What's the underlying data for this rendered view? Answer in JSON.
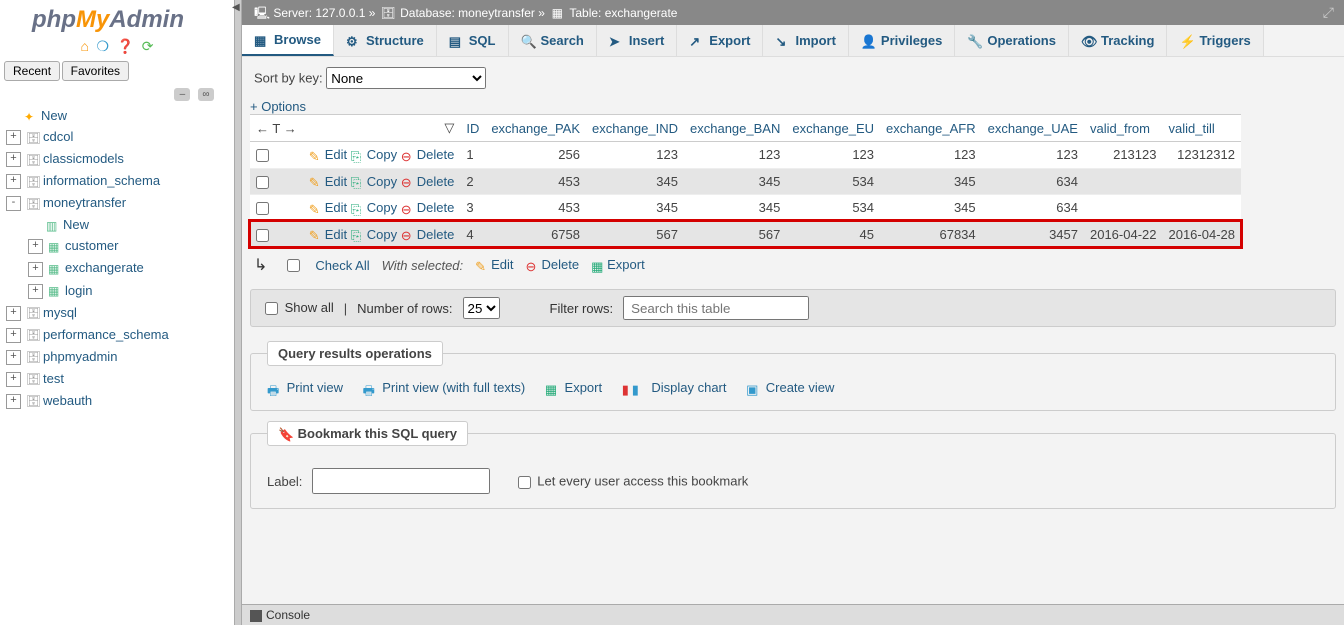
{
  "logo": {
    "p1": "php",
    "p2": "My",
    "p3": "Admin"
  },
  "sidebar": {
    "recent": "Recent",
    "favorites": "Favorites",
    "tree": [
      {
        "label": "New",
        "exp": "",
        "icon": "star"
      },
      {
        "label": "cdcol",
        "exp": "+",
        "icon": "db"
      },
      {
        "label": "classicmodels",
        "exp": "+",
        "icon": "db"
      },
      {
        "label": "information_schema",
        "exp": "+",
        "icon": "db"
      },
      {
        "label": "moneytransfer",
        "exp": "-",
        "icon": "db",
        "children": [
          {
            "label": "New",
            "exp": "",
            "icon": "new"
          },
          {
            "label": "customer",
            "exp": "+",
            "icon": "tbl"
          },
          {
            "label": "exchangerate",
            "exp": "+",
            "icon": "tbl"
          },
          {
            "label": "login",
            "exp": "+",
            "icon": "tbl"
          }
        ]
      },
      {
        "label": "mysql",
        "exp": "+",
        "icon": "db"
      },
      {
        "label": "performance_schema",
        "exp": "+",
        "icon": "db"
      },
      {
        "label": "phpmyadmin",
        "exp": "+",
        "icon": "db"
      },
      {
        "label": "test",
        "exp": "+",
        "icon": "db"
      },
      {
        "label": "webauth",
        "exp": "+",
        "icon": "db"
      }
    ]
  },
  "crumb": {
    "server_lbl": "Server:",
    "server": "127.0.0.1",
    "db_lbl": "Database:",
    "db": "moneytransfer",
    "tbl_lbl": "Table:",
    "tbl": "exchangerate"
  },
  "tabs": [
    {
      "id": "browse",
      "label": "Browse",
      "active": true
    },
    {
      "id": "structure",
      "label": "Structure"
    },
    {
      "id": "sql",
      "label": "SQL"
    },
    {
      "id": "search",
      "label": "Search"
    },
    {
      "id": "insert",
      "label": "Insert"
    },
    {
      "id": "export",
      "label": "Export"
    },
    {
      "id": "import",
      "label": "Import"
    },
    {
      "id": "privileges",
      "label": "Privileges"
    },
    {
      "id": "operations",
      "label": "Operations"
    },
    {
      "id": "tracking",
      "label": "Tracking"
    },
    {
      "id": "triggers",
      "label": "Triggers"
    }
  ],
  "sortkey": {
    "label": "Sort by key:",
    "value": "None"
  },
  "options": "+ Options",
  "columns": [
    "ID",
    "exchange_PAK",
    "exchange_IND",
    "exchange_BAN",
    "exchange_EU",
    "exchange_AFR",
    "exchange_UAE",
    "valid_from",
    "valid_till"
  ],
  "actions": {
    "edit": "Edit",
    "copy": "Copy",
    "delete": "Delete"
  },
  "rows": [
    {
      "id": "1",
      "pak": "256",
      "ind": "123",
      "ban": "123",
      "eu": "123",
      "afr": "123",
      "uae": "123",
      "from": "213123",
      "till": "12312312",
      "hl": false
    },
    {
      "id": "2",
      "pak": "453",
      "ind": "345",
      "ban": "345",
      "eu": "534",
      "afr": "345",
      "uae": "634",
      "from": "",
      "till": "",
      "hl": false
    },
    {
      "id": "3",
      "pak": "453",
      "ind": "345",
      "ban": "345",
      "eu": "534",
      "afr": "345",
      "uae": "634",
      "from": "",
      "till": "",
      "hl": false
    },
    {
      "id": "4",
      "pak": "6758",
      "ind": "567",
      "ban": "567",
      "eu": "45",
      "afr": "67834",
      "uae": "3457",
      "from": "2016-04-22",
      "till": "2016-04-28",
      "hl": true
    }
  ],
  "checkall": {
    "label": "Check All",
    "with": "With selected:",
    "edit": "Edit",
    "delete": "Delete",
    "export": "Export"
  },
  "pager": {
    "showall": "Show all",
    "numrows_lbl": "Number of rows:",
    "numrows": "25",
    "filter_lbl": "Filter rows:",
    "filter_ph": "Search this table"
  },
  "qro": {
    "legend": "Query results operations",
    "print": "Print view",
    "printfull": "Print view (with full texts)",
    "export": "Export",
    "chart": "Display chart",
    "createview": "Create view"
  },
  "bookmark": {
    "legend": "Bookmark this SQL query",
    "label": "Label:",
    "share": "Let every user access this bookmark"
  },
  "console": "Console"
}
